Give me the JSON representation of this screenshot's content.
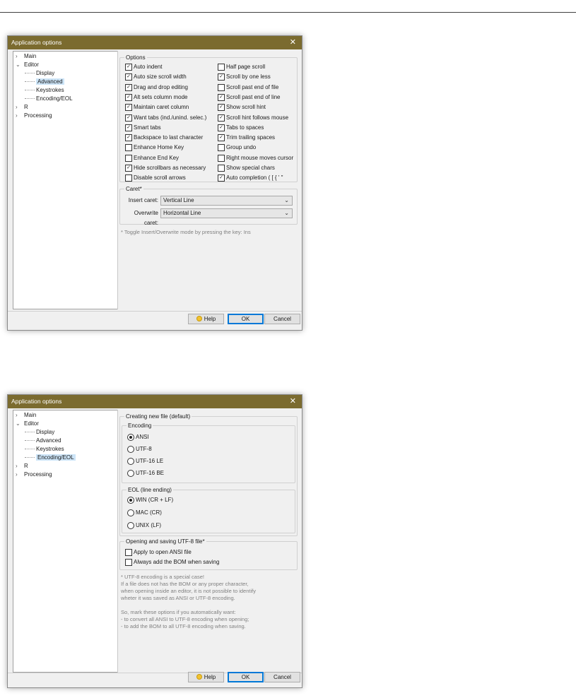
{
  "tree": {
    "main": "Main",
    "editor": "Editor",
    "display": "Display",
    "advanced": "Advanced",
    "keystrokes": "Keystrokes",
    "encoding": "Encoding/EOL",
    "r": "R",
    "processing": "Processing"
  },
  "dialog1": {
    "title": "Application options",
    "options_title": "Options",
    "options_left": [
      {
        "label": "Auto indent",
        "checked": true
      },
      {
        "label": "Auto size scroll width",
        "checked": true
      },
      {
        "label": "Drag and drop editing",
        "checked": true
      },
      {
        "label": "Alt sets column mode",
        "checked": true
      },
      {
        "label": "Maintain caret column",
        "checked": true
      },
      {
        "label": "Want tabs (ind./unind. selec.)",
        "checked": true
      },
      {
        "label": "Smart tabs",
        "checked": true
      },
      {
        "label": "Backspace to last character",
        "checked": true
      },
      {
        "label": "Enhance Home Key",
        "checked": false
      },
      {
        "label": "Enhance End Key",
        "checked": false
      },
      {
        "label": "Hide scrollbars as necessary",
        "checked": true
      },
      {
        "label": "Disable scroll arrows",
        "checked": false
      }
    ],
    "options_right": [
      {
        "label": "Half page scroll",
        "checked": false
      },
      {
        "label": "Scroll by one less",
        "checked": true
      },
      {
        "label": "Scroll past end of file",
        "checked": false
      },
      {
        "label": "Scroll past end of line",
        "checked": true
      },
      {
        "label": "Show scroll hint",
        "checked": true
      },
      {
        "label": "Scroll hint follows mouse",
        "checked": true
      },
      {
        "label": "Tabs to spaces",
        "checked": true
      },
      {
        "label": "Trim trailing spaces",
        "checked": true
      },
      {
        "label": "Group undo",
        "checked": false
      },
      {
        "label": "Right mouse moves cursor",
        "checked": false
      },
      {
        "label": "Show special chars",
        "checked": false
      },
      {
        "label": "Auto completion ( [ { ' \"",
        "checked": true
      }
    ],
    "caret_title": "Caret*",
    "insert_label": "Insert caret:",
    "insert_value": "Vertical Line",
    "overwrite_label": "Overwrite caret:",
    "overwrite_value": "Horizontal Line",
    "note": "* Toggle Insert/Overwrite mode by pressing the key: Ins"
  },
  "dialog2": {
    "title": "Application options",
    "new_file_title": "Creating new file (default)",
    "encoding_title": "Encoding",
    "encodings": [
      {
        "label": "ANSI",
        "selected": true
      },
      {
        "label": "UTF-8",
        "selected": false
      },
      {
        "label": "UTF-16 LE",
        "selected": false
      },
      {
        "label": "UTF-16 BE",
        "selected": false
      }
    ],
    "eol_title": "EOL (line ending)",
    "eols": [
      {
        "label": "WIN (CR + LF)",
        "selected": true
      },
      {
        "label": "MAC (CR)",
        "selected": false
      },
      {
        "label": "UNIX (LF)",
        "selected": false
      }
    ],
    "utf8_title": "Opening and saving UTF-8 file*",
    "apply_ansi": "Apply to open ANSI file",
    "add_bom": "Always add the BOM when saving",
    "note": "* UTF-8 encoding is a special case!\nIf a file does not has the BOM or any proper character,\nwhen opening inside an editor, it is not possible to identify\nwheter it was saved as ANSI or UTF-8 encoding.\n\nSo, mark these options if you automatically want:\n- to convert all ANSI to UTF-8 encoding when opening;\n- to add the BOM to all UTF-8 encoding when saving."
  },
  "buttons": {
    "help": "Help",
    "ok": "OK",
    "cancel": "Cancel",
    "close": "✕"
  }
}
